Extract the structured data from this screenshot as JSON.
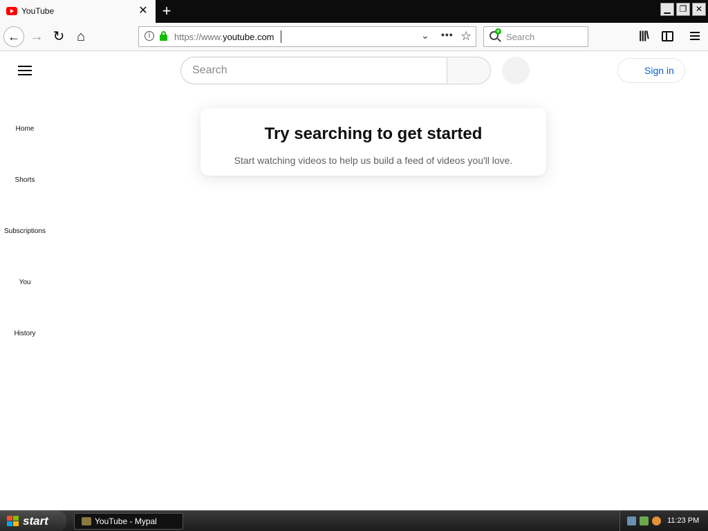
{
  "browser": {
    "tab_title": "YouTube",
    "tab_close": "✕",
    "new_tab": "+",
    "url_prefix": "https://www.",
    "url_domain": "youtube.com",
    "search_placeholder": "Search",
    "window_controls": {
      "minimize": "▁",
      "maximize": "❐",
      "close": "✕"
    },
    "icons": [
      "back-icon",
      "forward-icon",
      "reload-icon",
      "home-icon",
      "info-icon",
      "lock-icon",
      "dropdown-icon",
      "more-icon",
      "bookmark-star-icon",
      "search-icon",
      "library-icon",
      "sidebar-icon",
      "menu-icon"
    ]
  },
  "youtube": {
    "search_placeholder": "Search",
    "sign_in": "Sign in",
    "sidebar": [
      {
        "label": "Home"
      },
      {
        "label": "Shorts"
      },
      {
        "label": "Subscriptions"
      },
      {
        "label": "You"
      },
      {
        "label": "History"
      }
    ],
    "empty_state": {
      "title": "Try searching to get started",
      "subtitle": "Start watching videos to help us build a feed of videos you'll love."
    },
    "colors": {
      "link_blue": "#065fd4",
      "brand_red": "#ff0000"
    }
  },
  "taskbar": {
    "start": "start",
    "task_label": "YouTube - Mypal",
    "clock": "11:23 PM"
  }
}
